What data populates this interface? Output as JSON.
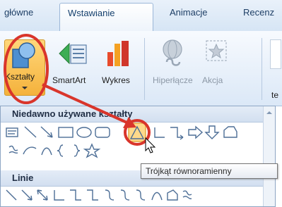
{
  "tabs": [
    {
      "label": "główne"
    },
    {
      "label": "Wstawianie"
    },
    {
      "label": "Animacje"
    },
    {
      "label": "Recenz"
    }
  ],
  "ribbon": {
    "shapes_label": "Kształty",
    "smartart_label": "SmartArt",
    "chart_label": "Wykres",
    "hyperlink_label": "Hiperłącze",
    "action_label": "Akcja",
    "cut_label": "te"
  },
  "shapes_panel": {
    "recent_header": "Niedawno używane kształty",
    "lines_header": "Linie"
  },
  "tooltip": {
    "text": "Trójkąt równoramienny"
  },
  "colors": {
    "highlight": "#d9352b",
    "accent_blue": "#15406e",
    "ribbon_bg": "#dbe8f7"
  }
}
